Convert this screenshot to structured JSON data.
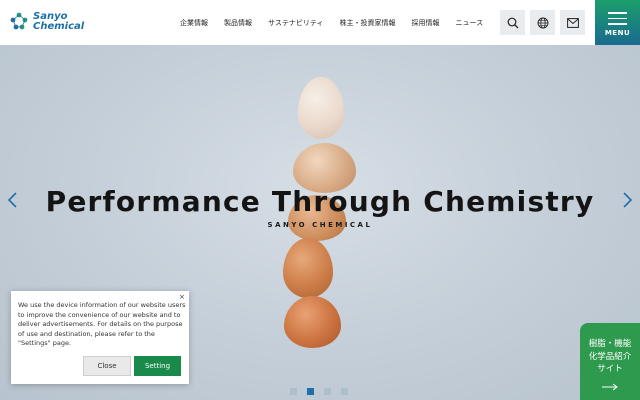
{
  "header": {
    "logo_line1": "Sanyo",
    "logo_line2": "Chemical",
    "nav": [
      "企業情報",
      "製品情報",
      "サステナビリティ",
      "株主・投資家情報",
      "採用情報",
      "ニュース"
    ],
    "icons": [
      "search-icon",
      "globe-icon",
      "mail-icon"
    ],
    "menu_label": "MENU"
  },
  "hero": {
    "title": "Performance Through Chemistry",
    "subtitle": "SANYO CHEMICAL",
    "slides_total": 4,
    "active_slide": 2
  },
  "cookie": {
    "text": "We use the device information of our website users to improve the convenience of our website and to deliver advertisements. For details on the purpose of use and destination, please refer to the \"Settings\" page.",
    "close_symbol": "×",
    "close_label": "Close",
    "setting_label": "Setting"
  },
  "side_tab": {
    "line1": "樹脂・機能",
    "line2": "化学品紹介",
    "line3": "サイト"
  },
  "colors": {
    "brand_blue": "#1f6fa8",
    "brand_green": "#1a8a4a",
    "side_tab_green": "#2e9a4e"
  }
}
